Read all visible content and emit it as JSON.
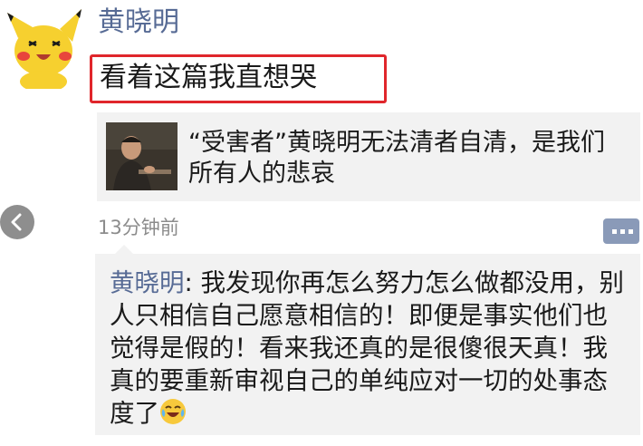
{
  "post": {
    "author": "黄晓明",
    "text": "看着这篇我直想哭",
    "time": "13分钟前",
    "avatar_icon": "pikachu-avatar-icon",
    "share": {
      "title": "“受害者”黄晓明无法清者自清，是我们所有人的悲哀",
      "thumbnail_icon": "person-photo-thumbnail"
    }
  },
  "comment": {
    "author": "黄晓明",
    "separator": ": ",
    "text": "我发现你再怎么努力怎么做都没用，别人只相信自己愿意相信的！即便是事实他们也觉得是假的！看来我还真的是很傻很天真！我真的要重新审视自己的单纯应对一切的处事态度了",
    "emoji_icon": "crying-laughing-emoji-icon"
  },
  "controls": {
    "back_icon": "chevron-left-icon",
    "comment_icon": "comment-dots-icon"
  },
  "colors": {
    "name_blue": "#576b95",
    "highlight_red": "#e0262b",
    "card_bg": "#f2f2f2",
    "meta_gray": "#8c8c8c"
  }
}
